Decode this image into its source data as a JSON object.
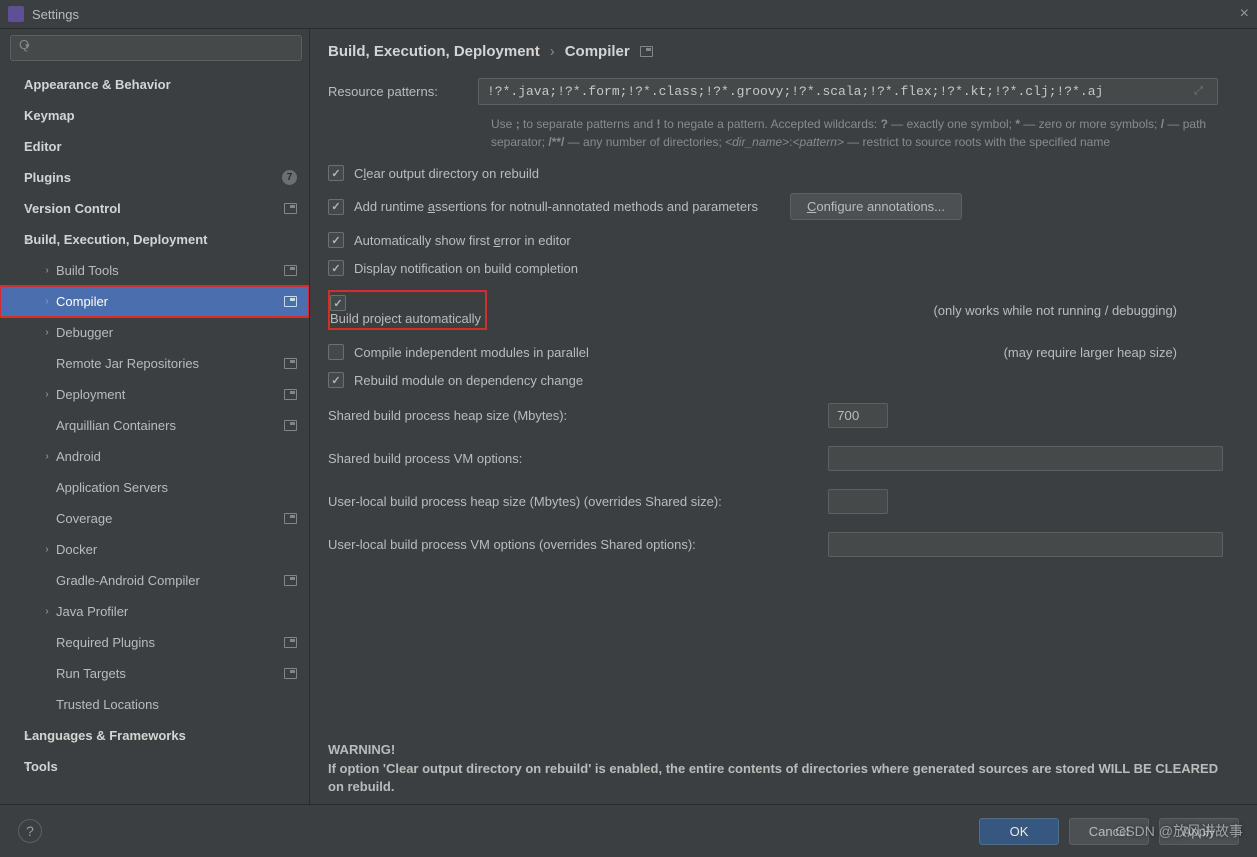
{
  "window": {
    "title": "Settings"
  },
  "search": {
    "placeholder": ""
  },
  "sidebar": {
    "items": [
      {
        "label": "Appearance & Behavior",
        "level": 0,
        "expandable": true
      },
      {
        "label": "Keymap",
        "level": 0
      },
      {
        "label": "Editor",
        "level": 0,
        "expandable": true
      },
      {
        "label": "Plugins",
        "level": 0,
        "badge": "7"
      },
      {
        "label": "Version Control",
        "level": 0,
        "expandable": true,
        "proj": true
      },
      {
        "label": "Build, Execution, Deployment",
        "level": 0,
        "expandable": true,
        "expanded": true
      },
      {
        "label": "Build Tools",
        "level": 1,
        "expandable": true,
        "proj": true
      },
      {
        "label": "Compiler",
        "level": 1,
        "expandable": true,
        "proj": true,
        "selected": true,
        "redbox": true
      },
      {
        "label": "Debugger",
        "level": 1,
        "expandable": true
      },
      {
        "label": "Remote Jar Repositories",
        "level": 1,
        "proj": true
      },
      {
        "label": "Deployment",
        "level": 1,
        "expandable": true,
        "proj": true
      },
      {
        "label": "Arquillian Containers",
        "level": 1,
        "proj": true
      },
      {
        "label": "Android",
        "level": 1,
        "expandable": true
      },
      {
        "label": "Application Servers",
        "level": 1
      },
      {
        "label": "Coverage",
        "level": 1,
        "proj": true
      },
      {
        "label": "Docker",
        "level": 1,
        "expandable": true
      },
      {
        "label": "Gradle-Android Compiler",
        "level": 1,
        "proj": true
      },
      {
        "label": "Java Profiler",
        "level": 1,
        "expandable": true
      },
      {
        "label": "Required Plugins",
        "level": 1,
        "proj": true
      },
      {
        "label": "Run Targets",
        "level": 1,
        "proj": true
      },
      {
        "label": "Trusted Locations",
        "level": 1
      },
      {
        "label": "Languages & Frameworks",
        "level": 0,
        "expandable": true
      },
      {
        "label": "Tools",
        "level": 0,
        "expandable": true
      }
    ]
  },
  "breadcrumb": {
    "parent": "Build, Execution, Deployment",
    "current": "Compiler"
  },
  "form": {
    "resource_label": "Resource patterns:",
    "resource_value": "!?*.java;!?*.form;!?*.class;!?*.groovy;!?*.scala;!?*.flex;!?*.kt;!?*.clj;!?*.aj",
    "help": "Use ; to separate patterns and ! to negate a pattern. Accepted wildcards: ? — exactly one symbol; * — zero or more symbols; / — path separator; /**/ — any number of directories; <dir_name>:<pattern> — restrict to source roots with the specified name",
    "opts": [
      {
        "label_html": "C<u>l</u>ear output directory on rebuild",
        "checked": true
      },
      {
        "label_html": "Add runtime <u>a</u>ssertions for notnull-annotated methods and parameters",
        "checked": true,
        "button": "Configure annotations..."
      },
      {
        "label_html": "Automatically show first <u>e</u>rror in editor",
        "checked": true
      },
      {
        "label_html": "Display notification on build completion",
        "checked": true
      },
      {
        "label_html": "Build project automatically",
        "checked": true,
        "hint": "(only works while not running / debugging)",
        "redbox": true
      },
      {
        "label_html": "Compile independent modules in parallel",
        "checked": false,
        "hint": "(may require larger heap size)"
      },
      {
        "label_html": "Rebuild module on dependency change",
        "checked": true
      }
    ],
    "fields": [
      {
        "label": "Shared build process heap size (Mbytes):",
        "value": "700",
        "size": "small"
      },
      {
        "label": "Shared build process VM options:",
        "value": "",
        "size": "wide"
      },
      {
        "label": "User-local build process heap size (Mbytes) (overrides Shared size):",
        "value": "",
        "size": "small"
      },
      {
        "label": "User-local build process VM options (overrides Shared options):",
        "value": "",
        "size": "wide"
      }
    ],
    "warning_title": "WARNING!",
    "warning_body": "If option 'Clear output directory on rebuild' is enabled, the entire contents of directories where generated sources are stored WILL BE CLEARED on rebuild."
  },
  "footer": {
    "ok": "OK",
    "cancel": "Cancel",
    "apply": "Apply"
  },
  "watermark": "CSDN @放风讲故事"
}
